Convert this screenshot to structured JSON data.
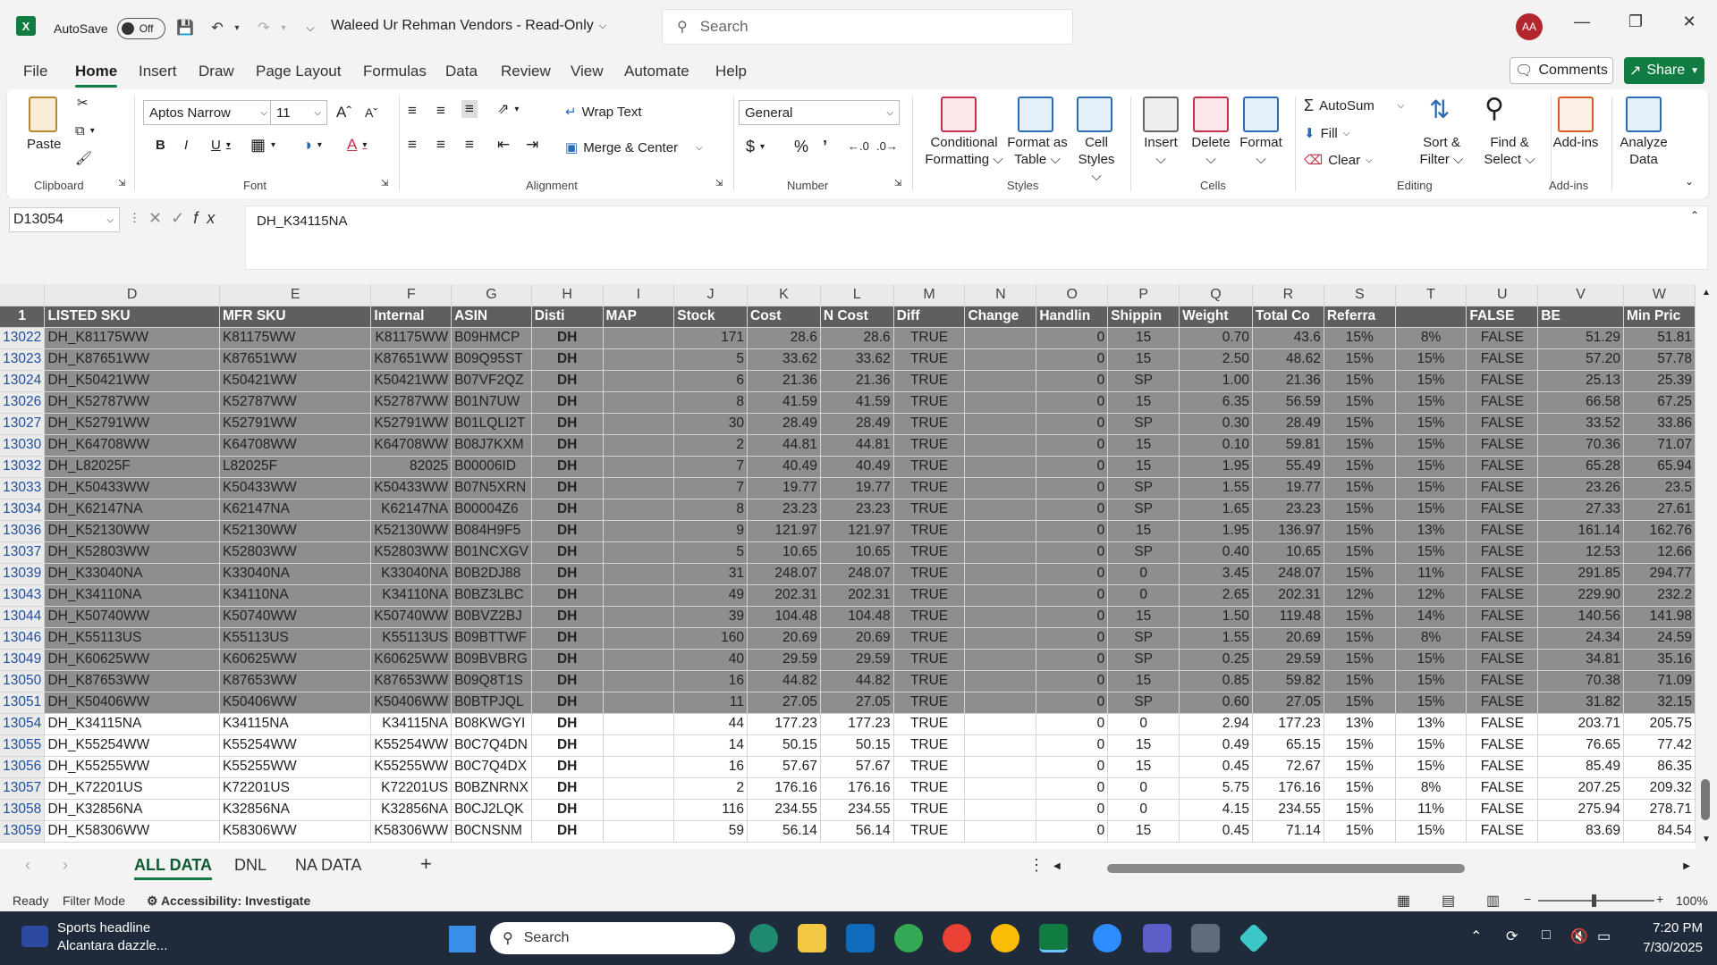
{
  "titlebar": {
    "autosave": "AutoSave",
    "toggle": "Off",
    "doc_title": "Waleed Ur Rehman Vendors  -  Read-Only",
    "search_placeholder": "Search",
    "avatar": "AA"
  },
  "menu": {
    "items": [
      "File",
      "Home",
      "Insert",
      "Draw",
      "Page Layout",
      "Formulas",
      "Data",
      "Review",
      "View",
      "Automate",
      "Help"
    ],
    "comments": "Comments",
    "share": "Share"
  },
  "ribbon": {
    "clipboard": {
      "paste": "Paste",
      "label": "Clipboard"
    },
    "font": {
      "family": "Aptos Narrow",
      "size": "11",
      "label": "Font"
    },
    "alignment": {
      "wrap": "Wrap Text",
      "merge": "Merge & Center",
      "label": "Alignment"
    },
    "number": {
      "format": "General",
      "label": "Number"
    },
    "styles": {
      "cond": "Conditional",
      "cond2": "Formatting",
      "fat": "Format as",
      "fat2": "Table",
      "cell": "Cell",
      "cell2": "Styles",
      "label": "Styles"
    },
    "cells": {
      "insert": "Insert",
      "delete": "Delete",
      "format": "Format",
      "label": "Cells"
    },
    "editing": {
      "autosum": "AutoSum",
      "fill": "Fill",
      "clear": "Clear",
      "sort": "Sort &",
      "sort2": "Filter",
      "find": "Find &",
      "find2": "Select",
      "label": "Editing"
    },
    "addins": {
      "addins": "Add-ins",
      "label": "Add-ins",
      "analyze": "Analyze",
      "analyze2": "Data"
    }
  },
  "formula": {
    "namebox": "D13054",
    "content": "DH_K34115NA"
  },
  "columns": [
    "D",
    "E",
    "F",
    "G",
    "H",
    "I",
    "J",
    "K",
    "L",
    "M",
    "N",
    "O",
    "P",
    "Q",
    "R",
    "S",
    "T",
    "U",
    "V",
    "W"
  ],
  "header_row": {
    "num": "1",
    "cells": [
      "LISTED SKU",
      "MFR SKU",
      "Internal",
      "ASIN",
      "Disti",
      "MAP",
      "Stock",
      "Cost",
      "N Cost",
      "Diff",
      "Change",
      "Handlin",
      "Shippin",
      "Weight",
      "Total Co",
      "Referra",
      "",
      "FALSE",
      "BE",
      "Min Pric"
    ]
  },
  "rows": [
    {
      "n": "13022",
      "sel": true,
      "c": [
        "DH_K81175WW",
        "K81175WW",
        "K81175WW",
        "B09HMCP",
        "DH",
        "",
        "171",
        "28.6",
        "28.6",
        "TRUE",
        "",
        "0",
        "15",
        "0.70",
        "43.6",
        "15%",
        "8%",
        "FALSE",
        "51.29",
        "51.81"
      ]
    },
    {
      "n": "13023",
      "sel": true,
      "c": [
        "DH_K87651WW",
        "K87651WW",
        "K87651WW",
        "B09Q95ST",
        "DH",
        "",
        "5",
        "33.62",
        "33.62",
        "TRUE",
        "",
        "0",
        "15",
        "2.50",
        "48.62",
        "15%",
        "15%",
        "FALSE",
        "57.20",
        "57.78"
      ]
    },
    {
      "n": "13024",
      "sel": true,
      "c": [
        "DH_K50421WW",
        "K50421WW",
        "K50421WW",
        "B07VF2QZ",
        "DH",
        "",
        "6",
        "21.36",
        "21.36",
        "TRUE",
        "",
        "0",
        "SP",
        "1.00",
        "21.36",
        "15%",
        "15%",
        "FALSE",
        "25.13",
        "25.39"
      ]
    },
    {
      "n": "13026",
      "sel": true,
      "c": [
        "DH_K52787WW",
        "K52787WW",
        "K52787WW",
        "B01N7UW",
        "DH",
        "",
        "8",
        "41.59",
        "41.59",
        "TRUE",
        "",
        "0",
        "15",
        "6.35",
        "56.59",
        "15%",
        "15%",
        "FALSE",
        "66.58",
        "67.25"
      ]
    },
    {
      "n": "13027",
      "sel": true,
      "c": [
        "DH_K52791WW",
        "K52791WW",
        "K52791WW",
        "B01LQLI2T",
        "DH",
        "",
        "30",
        "28.49",
        "28.49",
        "TRUE",
        "",
        "0",
        "SP",
        "0.30",
        "28.49",
        "15%",
        "15%",
        "FALSE",
        "33.52",
        "33.86"
      ]
    },
    {
      "n": "13030",
      "sel": true,
      "c": [
        "DH_K64708WW",
        "K64708WW",
        "K64708WW",
        "B08J7KXM",
        "DH",
        "",
        "2",
        "44.81",
        "44.81",
        "TRUE",
        "",
        "0",
        "15",
        "0.10",
        "59.81",
        "15%",
        "15%",
        "FALSE",
        "70.36",
        "71.07"
      ]
    },
    {
      "n": "13032",
      "sel": true,
      "c": [
        "DH_L82025F",
        "L82025F",
        "82025",
        "B00006ID",
        "DH",
        "",
        "7",
        "40.49",
        "40.49",
        "TRUE",
        "",
        "0",
        "15",
        "1.95",
        "55.49",
        "15%",
        "15%",
        "FALSE",
        "65.28",
        "65.94"
      ]
    },
    {
      "n": "13033",
      "sel": true,
      "c": [
        "DH_K50433WW",
        "K50433WW",
        "K50433WW",
        "B07N5XRN",
        "DH",
        "",
        "7",
        "19.77",
        "19.77",
        "TRUE",
        "",
        "0",
        "SP",
        "1.55",
        "19.77",
        "15%",
        "15%",
        "FALSE",
        "23.26",
        "23.5"
      ]
    },
    {
      "n": "13034",
      "sel": true,
      "c": [
        "DH_K62147NA",
        "K62147NA",
        "K62147NA",
        "B00004Z6",
        "DH",
        "",
        "8",
        "23.23",
        "23.23",
        "TRUE",
        "",
        "0",
        "SP",
        "1.65",
        "23.23",
        "15%",
        "15%",
        "FALSE",
        "27.33",
        "27.61"
      ]
    },
    {
      "n": "13036",
      "sel": true,
      "c": [
        "DH_K52130WW",
        "K52130WW",
        "K52130WW",
        "B084H9F5",
        "DH",
        "",
        "9",
        "121.97",
        "121.97",
        "TRUE",
        "",
        "0",
        "15",
        "1.95",
        "136.97",
        "15%",
        "13%",
        "FALSE",
        "161.14",
        "162.76"
      ]
    },
    {
      "n": "13037",
      "sel": true,
      "c": [
        "DH_K52803WW",
        "K52803WW",
        "K52803WW",
        "B01NCXGV",
        "DH",
        "",
        "5",
        "10.65",
        "10.65",
        "TRUE",
        "",
        "0",
        "SP",
        "0.40",
        "10.65",
        "15%",
        "15%",
        "FALSE",
        "12.53",
        "12.66"
      ]
    },
    {
      "n": "13039",
      "sel": true,
      "c": [
        "DH_K33040NA",
        "K33040NA",
        "K33040NA",
        "B0B2DJ88",
        "DH",
        "",
        "31",
        "248.07",
        "248.07",
        "TRUE",
        "",
        "0",
        "0",
        "3.45",
        "248.07",
        "15%",
        "11%",
        "FALSE",
        "291.85",
        "294.77"
      ]
    },
    {
      "n": "13043",
      "sel": true,
      "c": [
        "DH_K34110NA",
        "K34110NA",
        "K34110NA",
        "B0BZ3LBC",
        "DH",
        "",
        "49",
        "202.31",
        "202.31",
        "TRUE",
        "",
        "0",
        "0",
        "2.65",
        "202.31",
        "12%",
        "12%",
        "FALSE",
        "229.90",
        "232.2"
      ]
    },
    {
      "n": "13044",
      "sel": true,
      "c": [
        "DH_K50740WW",
        "K50740WW",
        "K50740WW",
        "B0BVZ2BJ",
        "DH",
        "",
        "39",
        "104.48",
        "104.48",
        "TRUE",
        "",
        "0",
        "15",
        "1.50",
        "119.48",
        "15%",
        "14%",
        "FALSE",
        "140.56",
        "141.98"
      ]
    },
    {
      "n": "13046",
      "sel": true,
      "c": [
        "DH_K55113US",
        "K55113US",
        "K55113US",
        "B09BTTWF",
        "DH",
        "",
        "160",
        "20.69",
        "20.69",
        "TRUE",
        "",
        "0",
        "SP",
        "1.55",
        "20.69",
        "15%",
        "8%",
        "FALSE",
        "24.34",
        "24.59"
      ]
    },
    {
      "n": "13049",
      "sel": true,
      "c": [
        "DH_K60625WW",
        "K60625WW",
        "K60625WW",
        "B09BVBRG",
        "DH",
        "",
        "40",
        "29.59",
        "29.59",
        "TRUE",
        "",
        "0",
        "SP",
        "0.25",
        "29.59",
        "15%",
        "15%",
        "FALSE",
        "34.81",
        "35.16"
      ]
    },
    {
      "n": "13050",
      "sel": true,
      "c": [
        "DH_K87653WW",
        "K87653WW",
        "K87653WW",
        "B09Q8T1S",
        "DH",
        "",
        "16",
        "44.82",
        "44.82",
        "TRUE",
        "",
        "0",
        "15",
        "0.85",
        "59.82",
        "15%",
        "15%",
        "FALSE",
        "70.38",
        "71.09"
      ]
    },
    {
      "n": "13051",
      "sel": true,
      "c": [
        "DH_K50406WW",
        "K50406WW",
        "K50406WW",
        "B0BTPJQL",
        "DH",
        "",
        "11",
        "27.05",
        "27.05",
        "TRUE",
        "",
        "0",
        "SP",
        "0.60",
        "27.05",
        "15%",
        "15%",
        "FALSE",
        "31.82",
        "32.15"
      ]
    },
    {
      "n": "13054",
      "sel": false,
      "c": [
        "DH_K34115NA",
        "K34115NA",
        "K34115NA",
        "B08KWGYI",
        "DH",
        "",
        "44",
        "177.23",
        "177.23",
        "TRUE",
        "",
        "0",
        "0",
        "2.94",
        "177.23",
        "13%",
        "13%",
        "FALSE",
        "203.71",
        "205.75"
      ]
    },
    {
      "n": "13055",
      "sel": false,
      "c": [
        "DH_K55254WW",
        "K55254WW",
        "K55254WW",
        "B0C7Q4DN",
        "DH",
        "",
        "14",
        "50.15",
        "50.15",
        "TRUE",
        "",
        "0",
        "15",
        "0.49",
        "65.15",
        "15%",
        "15%",
        "FALSE",
        "76.65",
        "77.42"
      ]
    },
    {
      "n": "13056",
      "sel": false,
      "c": [
        "DH_K55255WW",
        "K55255WW",
        "K55255WW",
        "B0C7Q4DX",
        "DH",
        "",
        "16",
        "57.67",
        "57.67",
        "TRUE",
        "",
        "0",
        "15",
        "0.45",
        "72.67",
        "15%",
        "15%",
        "FALSE",
        "85.49",
        "86.35"
      ]
    },
    {
      "n": "13057",
      "sel": false,
      "c": [
        "DH_K72201US",
        "K72201US",
        "K72201US",
        "B0BZNRNX",
        "DH",
        "",
        "2",
        "176.16",
        "176.16",
        "TRUE",
        "",
        "0",
        "0",
        "5.75",
        "176.16",
        "15%",
        "8%",
        "FALSE",
        "207.25",
        "209.32"
      ]
    },
    {
      "n": "13058",
      "sel": false,
      "c": [
        "DH_K32856NA",
        "K32856NA",
        "K32856NA",
        "B0CJ2LQK",
        "DH",
        "",
        "116",
        "234.55",
        "234.55",
        "TRUE",
        "",
        "0",
        "0",
        "4.15",
        "234.55",
        "15%",
        "11%",
        "FALSE",
        "275.94",
        "278.71"
      ]
    },
    {
      "n": "13059",
      "sel": false,
      "c": [
        "DH_K58306WW",
        "K58306WW",
        "K58306WW",
        "B0CNSNM",
        "DH",
        "",
        "59",
        "56.14",
        "56.14",
        "TRUE",
        "",
        "0",
        "15",
        "0.45",
        "71.14",
        "15%",
        "15%",
        "FALSE",
        "83.69",
        "84.54"
      ]
    }
  ],
  "tabs": [
    "ALL DATA",
    "DNL",
    "NA DATA"
  ],
  "status": {
    "ready": "Ready",
    "filter": "Filter Mode",
    "access": "Accessibility: Investigate",
    "zoom": "100%"
  },
  "taskbar": {
    "news_title": "Sports headline",
    "news_sub": "Alcantara dazzle...",
    "search": "Search",
    "time": "7:20 PM",
    "date": "7/30/2025"
  }
}
